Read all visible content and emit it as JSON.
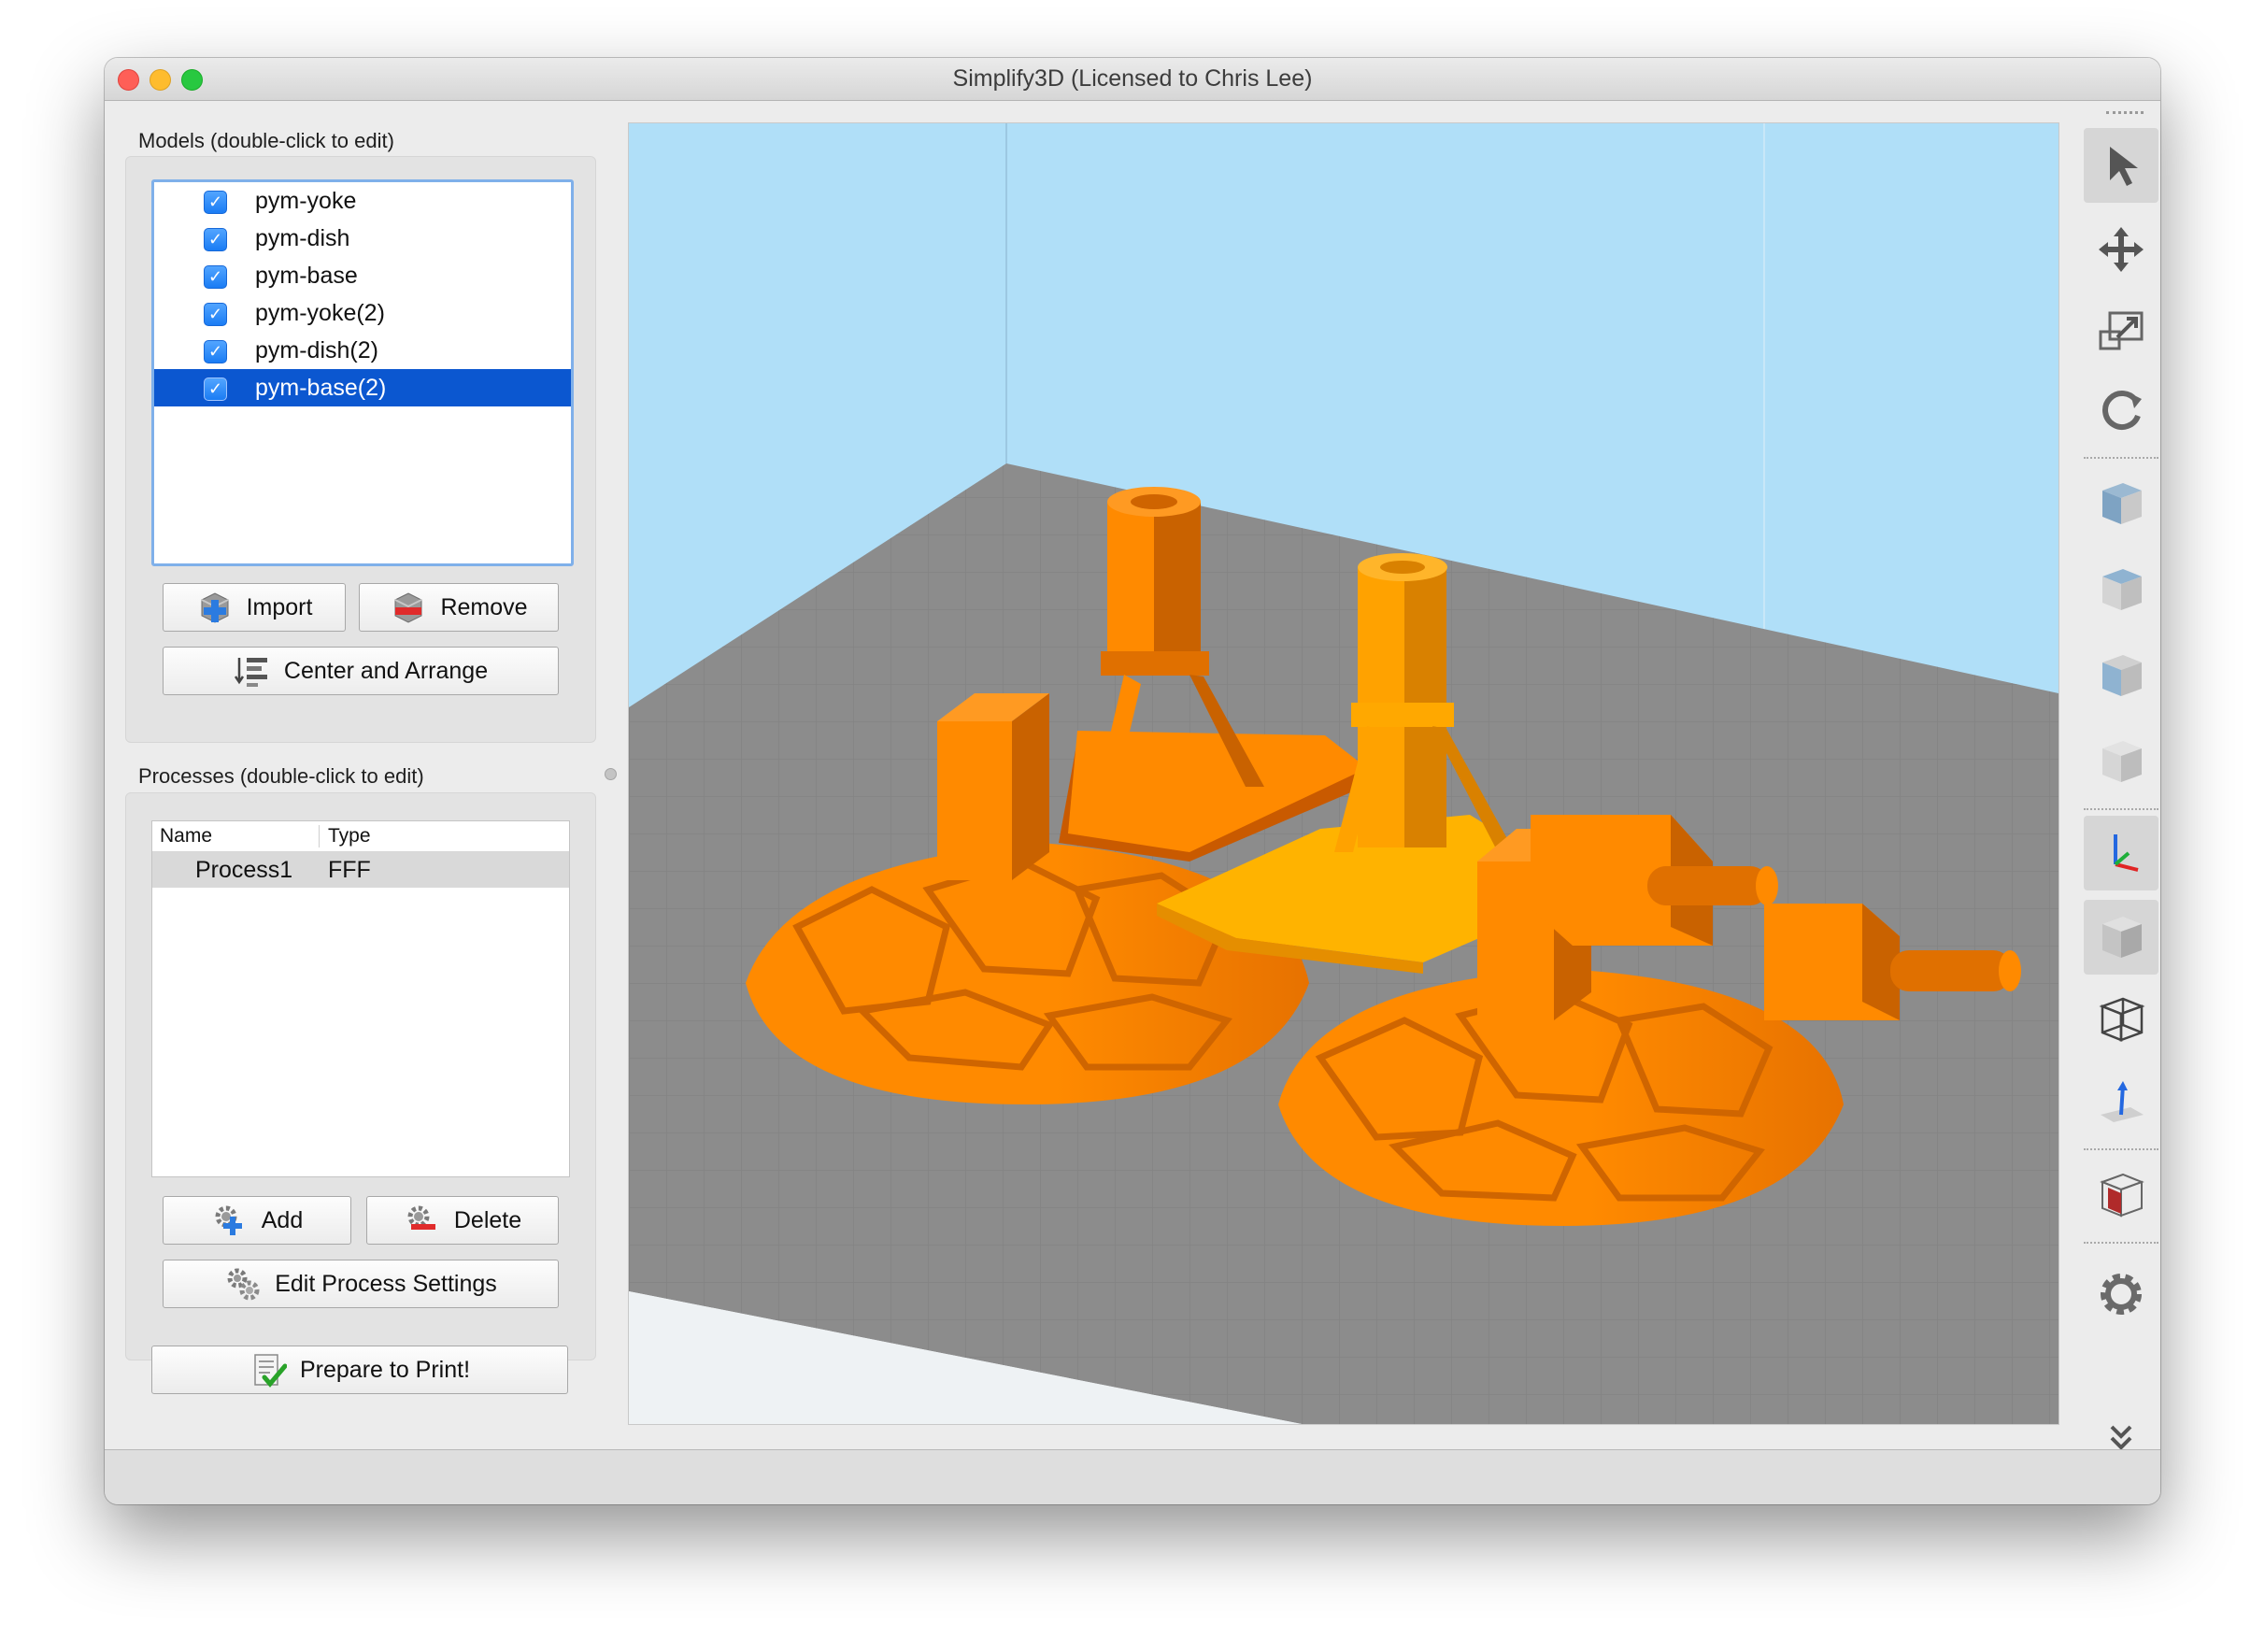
{
  "window": {
    "title": "Simplify3D (Licensed to Chris Lee)",
    "traffic_lights": {
      "close": "#fe5f57",
      "minimize": "#febc2e",
      "zoom": "#28c840"
    }
  },
  "models_panel": {
    "label": "Models (double-click to edit)",
    "items": [
      {
        "name": "pym-yoke",
        "checked": true
      },
      {
        "name": "pym-dish",
        "checked": true
      },
      {
        "name": "pym-base",
        "checked": true
      },
      {
        "name": "pym-yoke(2)",
        "checked": true
      },
      {
        "name": "pym-dish(2)",
        "checked": true
      },
      {
        "name": "pym-base(2)",
        "checked": true,
        "selected": true
      }
    ],
    "import_label": "Import",
    "remove_label": "Remove",
    "center_arrange_label": "Center and Arrange"
  },
  "processes_panel": {
    "label": "Processes (double-click to edit)",
    "columns": [
      "Name",
      "Type"
    ],
    "rows": [
      {
        "name": "Process1",
        "type": "FFF"
      }
    ],
    "add_label": "Add",
    "delete_label": "Delete",
    "edit_settings_label": "Edit Process Settings",
    "prepare_label": "Prepare to Print!"
  },
  "toolbar": {
    "icons": [
      "select-icon",
      "move-icon",
      "scale-icon",
      "rotate-icon",
      "iso-view-icon",
      "front-view-icon",
      "top-view-icon",
      "side-view-icon",
      "axes-icon",
      "solid-view-icon",
      "wireframe-view-icon",
      "normals-icon",
      "cross-section-icon",
      "settings-gear-icon",
      "expand-chevron-icon"
    ]
  },
  "colors": {
    "accent_selection": "#0b57d0",
    "model_orange": "#ff8a00",
    "model_selected": "#ffab00",
    "bed_gray": "#8c8c8c",
    "sky_blue": "#b0dff8"
  }
}
